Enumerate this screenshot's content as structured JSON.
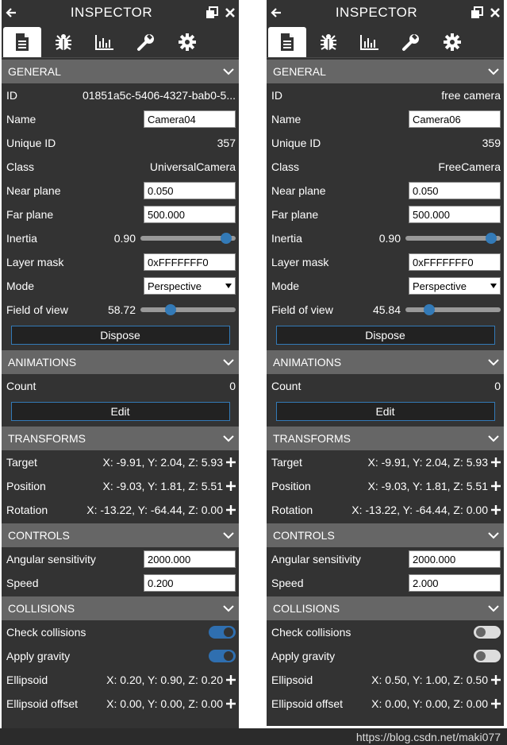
{
  "panels": [
    {
      "title": "INSPECTOR",
      "general": {
        "header": "GENERAL",
        "id_label": "ID",
        "id_value": "01851a5c-5406-4327-bab0-5...",
        "name_label": "Name",
        "name_value": "Camera04",
        "uid_label": "Unique ID",
        "uid_value": "357",
        "class_label": "Class",
        "class_value": "UniversalCamera",
        "near_label": "Near plane",
        "near_value": "0.050",
        "far_label": "Far plane",
        "far_value": "500.000",
        "inertia_label": "Inertia",
        "inertia_value": "0.90",
        "inertia_pos": 0.9,
        "layer_label": "Layer mask",
        "layer_value": "0xFFFFFFF0",
        "mode_label": "Mode",
        "mode_value": "Perspective",
        "fov_label": "Field of view",
        "fov_value": "58.72",
        "fov_pos": 0.32,
        "dispose_label": "Dispose"
      },
      "animations": {
        "header": "ANIMATIONS",
        "count_label": "Count",
        "count_value": "0",
        "edit_label": "Edit"
      },
      "transforms": {
        "header": "TRANSFORMS",
        "target_label": "Target",
        "target_value": "X: -9.91, Y: 2.04, Z: 5.93",
        "position_label": "Position",
        "position_value": "X: -9.03, Y: 1.81, Z: 5.51",
        "rotation_label": "Rotation",
        "rotation_value": "X: -13.22, Y: -64.44, Z: 0.00"
      },
      "controls": {
        "header": "CONTROLS",
        "angular_label": "Angular sensitivity",
        "angular_value": "2000.000",
        "speed_label": "Speed",
        "speed_value": "0.200"
      },
      "collisions": {
        "header": "COLLISIONS",
        "check_label": "Check collisions",
        "check_on": true,
        "gravity_label": "Apply gravity",
        "gravity_on": true,
        "ellipsoid_label": "Ellipsoid",
        "ellipsoid_value": "X: 0.20, Y: 0.90, Z: 0.20",
        "offset_label": "Ellipsoid offset",
        "offset_value": "X: 0.00, Y: 0.00, Z: 0.00"
      }
    },
    {
      "title": "INSPECTOR",
      "general": {
        "header": "GENERAL",
        "id_label": "ID",
        "id_value": "free camera",
        "name_label": "Name",
        "name_value": "Camera06",
        "uid_label": "Unique ID",
        "uid_value": "359",
        "class_label": "Class",
        "class_value": "FreeCamera",
        "near_label": "Near plane",
        "near_value": "0.050",
        "far_label": "Far plane",
        "far_value": "500.000",
        "inertia_label": "Inertia",
        "inertia_value": "0.90",
        "inertia_pos": 0.9,
        "layer_label": "Layer mask",
        "layer_value": "0xFFFFFFF0",
        "mode_label": "Mode",
        "mode_value": "Perspective",
        "fov_label": "Field of view",
        "fov_value": "45.84",
        "fov_pos": 0.25,
        "dispose_label": "Dispose"
      },
      "animations": {
        "header": "ANIMATIONS",
        "count_label": "Count",
        "count_value": "0",
        "edit_label": "Edit"
      },
      "transforms": {
        "header": "TRANSFORMS",
        "target_label": "Target",
        "target_value": "X: -9.91, Y: 2.04, Z: 5.93",
        "position_label": "Position",
        "position_value": "X: -9.03, Y: 1.81, Z: 5.51",
        "rotation_label": "Rotation",
        "rotation_value": "X: -13.22, Y: -64.44, Z: 0.00"
      },
      "controls": {
        "header": "CONTROLS",
        "angular_label": "Angular sensitivity",
        "angular_value": "2000.000",
        "speed_label": "Speed",
        "speed_value": "2.000"
      },
      "collisions": {
        "header": "COLLISIONS",
        "check_label": "Check collisions",
        "check_on": false,
        "gravity_label": "Apply gravity",
        "gravity_on": false,
        "ellipsoid_label": "Ellipsoid",
        "ellipsoid_value": "X: 0.50, Y: 1.00, Z: 0.50",
        "offset_label": "Ellipsoid offset",
        "offset_value": "X: 0.00, Y: 0.00, Z: 0.00"
      }
    }
  ],
  "watermark": "https://blog.csdn.net/maki077",
  "colors": {
    "panel_bg": "#333333",
    "header_bg": "#666666",
    "accent": "#337ab7"
  },
  "icons": [
    "back-arrow-icon",
    "popout-icon",
    "close-icon",
    "document-icon",
    "bug-icon",
    "stats-icon",
    "wrench-icon",
    "gear-icon",
    "chevron-down-icon",
    "plus-icon"
  ]
}
